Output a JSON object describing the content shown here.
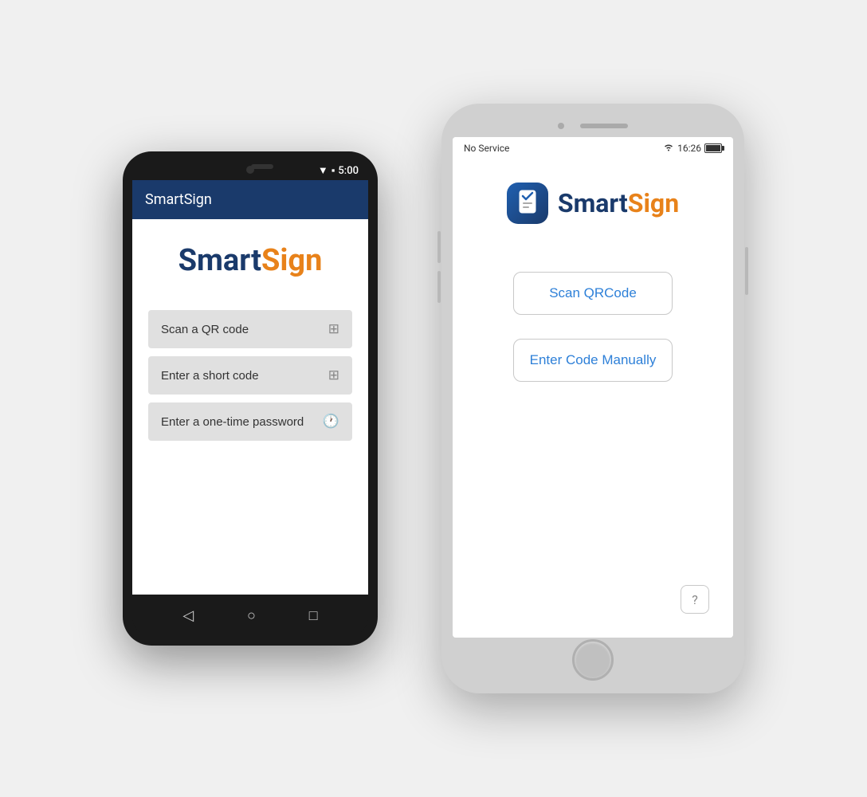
{
  "android": {
    "status_bar": {
      "time": "5:00",
      "signal_icon": "▼",
      "battery_icon": "🔋"
    },
    "header": {
      "title": "SmartSign"
    },
    "logo": {
      "smart": "Smart",
      "sign": "Sign"
    },
    "buttons": [
      {
        "label": "Scan a QR code",
        "icon": "⊞"
      },
      {
        "label": "Enter a short code",
        "icon": "⊞"
      },
      {
        "label": "Enter a one-time password",
        "icon": "🕐"
      }
    ],
    "nav": {
      "back": "◁",
      "home": "○",
      "recent": "□"
    }
  },
  "ios": {
    "status_bar": {
      "carrier": "No Service",
      "wifi_icon": "wifi",
      "time": "16:26",
      "battery": "battery"
    },
    "logo": {
      "smart": "Smart",
      "sign": "Sign",
      "icon": "✓"
    },
    "buttons": [
      {
        "label": "Scan QRCode"
      },
      {
        "label": "Enter Code Manually"
      }
    ],
    "help_button": "?"
  }
}
